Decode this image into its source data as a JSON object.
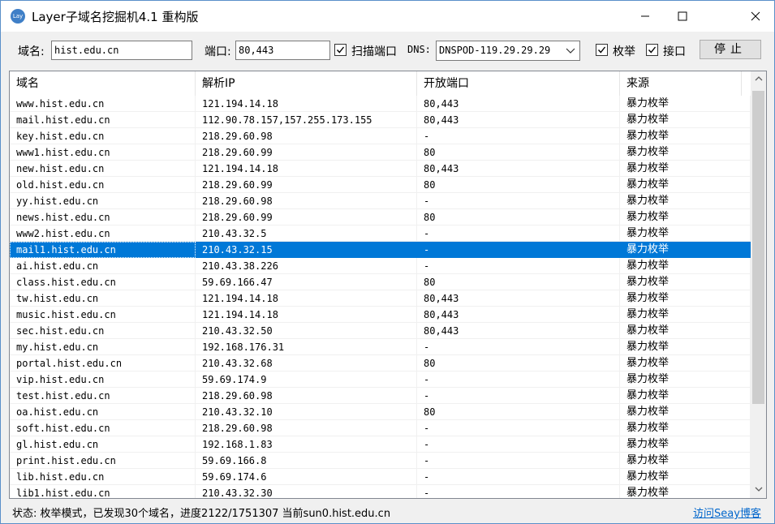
{
  "window": {
    "icon_text": "Lay",
    "title": "Layer子域名挖掘机4.1 重构版",
    "min_glyph": "—",
    "max_glyph": "☐",
    "close_glyph": "✕"
  },
  "toolbar": {
    "domain_label": "域名:",
    "domain_value": "hist.edu.cn",
    "port_label": "端口:",
    "port_value": "80,443",
    "scan_port_label": "扫描端口",
    "scan_port_checked": true,
    "dns_label": "DNS:",
    "dns_value": "DNSPOD-119.29.29.29",
    "enum_label": "枚举",
    "enum_checked": true,
    "api_label": "接口",
    "api_checked": true,
    "stop_label": "停止"
  },
  "table": {
    "columns": [
      "域名",
      "解析IP",
      "开放端口",
      "来源"
    ],
    "rows": [
      {
        "domain": "www.hist.edu.cn",
        "ip": "121.194.14.18",
        "ports": "80,443",
        "source": "暴力枚举"
      },
      {
        "domain": "mail.hist.edu.cn",
        "ip": "112.90.78.157,157.255.173.155",
        "ports": "80,443",
        "source": "暴力枚举"
      },
      {
        "domain": "key.hist.edu.cn",
        "ip": "218.29.60.98",
        "ports": "-",
        "source": "暴力枚举"
      },
      {
        "domain": "www1.hist.edu.cn",
        "ip": "218.29.60.99",
        "ports": "80",
        "source": "暴力枚举"
      },
      {
        "domain": "new.hist.edu.cn",
        "ip": "121.194.14.18",
        "ports": "80,443",
        "source": "暴力枚举"
      },
      {
        "domain": "old.hist.edu.cn",
        "ip": "218.29.60.99",
        "ports": "80",
        "source": "暴力枚举"
      },
      {
        "domain": "yy.hist.edu.cn",
        "ip": "218.29.60.98",
        "ports": "-",
        "source": "暴力枚举"
      },
      {
        "domain": "news.hist.edu.cn",
        "ip": "218.29.60.99",
        "ports": "80",
        "source": "暴力枚举"
      },
      {
        "domain": "www2.hist.edu.cn",
        "ip": "210.43.32.5",
        "ports": "-",
        "source": "暴力枚举"
      },
      {
        "domain": "mail1.hist.edu.cn",
        "ip": "210.43.32.15",
        "ports": "-",
        "source": "暴力枚举",
        "selected": true
      },
      {
        "domain": "ai.hist.edu.cn",
        "ip": "210.43.38.226",
        "ports": "-",
        "source": "暴力枚举"
      },
      {
        "domain": "class.hist.edu.cn",
        "ip": "59.69.166.47",
        "ports": "80",
        "source": "暴力枚举"
      },
      {
        "domain": "tw.hist.edu.cn",
        "ip": "121.194.14.18",
        "ports": "80,443",
        "source": "暴力枚举"
      },
      {
        "domain": "music.hist.edu.cn",
        "ip": "121.194.14.18",
        "ports": "80,443",
        "source": "暴力枚举"
      },
      {
        "domain": "sec.hist.edu.cn",
        "ip": "210.43.32.50",
        "ports": "80,443",
        "source": "暴力枚举"
      },
      {
        "domain": "my.hist.edu.cn",
        "ip": "192.168.176.31",
        "ports": "-",
        "source": "暴力枚举"
      },
      {
        "domain": "portal.hist.edu.cn",
        "ip": "210.43.32.68",
        "ports": "80",
        "source": "暴力枚举"
      },
      {
        "domain": "vip.hist.edu.cn",
        "ip": "59.69.174.9",
        "ports": "-",
        "source": "暴力枚举"
      },
      {
        "domain": "test.hist.edu.cn",
        "ip": "218.29.60.98",
        "ports": "-",
        "source": "暴力枚举"
      },
      {
        "domain": "oa.hist.edu.cn",
        "ip": "210.43.32.10",
        "ports": "80",
        "source": "暴力枚举"
      },
      {
        "domain": "soft.hist.edu.cn",
        "ip": "218.29.60.98",
        "ports": "-",
        "source": "暴力枚举"
      },
      {
        "domain": "gl.hist.edu.cn",
        "ip": "192.168.1.83",
        "ports": "-",
        "source": "暴力枚举"
      },
      {
        "domain": "print.hist.edu.cn",
        "ip": "59.69.166.8",
        "ports": "-",
        "source": "暴力枚举"
      },
      {
        "domain": "lib.hist.edu.cn",
        "ip": "59.69.174.6",
        "ports": "-",
        "source": "暴力枚举"
      },
      {
        "domain": "lib1.hist.edu.cn",
        "ip": "210.43.32.30",
        "ports": "-",
        "source": "暴力枚举"
      }
    ]
  },
  "scrollbar": {
    "up_glyph": "︿",
    "down_glyph": "﹀"
  },
  "status": {
    "text": "状态: 枚举模式，已发现30个域名，进度2122/1751307  当前sun0.hist.edu.cn",
    "link": "访问Seay博客"
  }
}
